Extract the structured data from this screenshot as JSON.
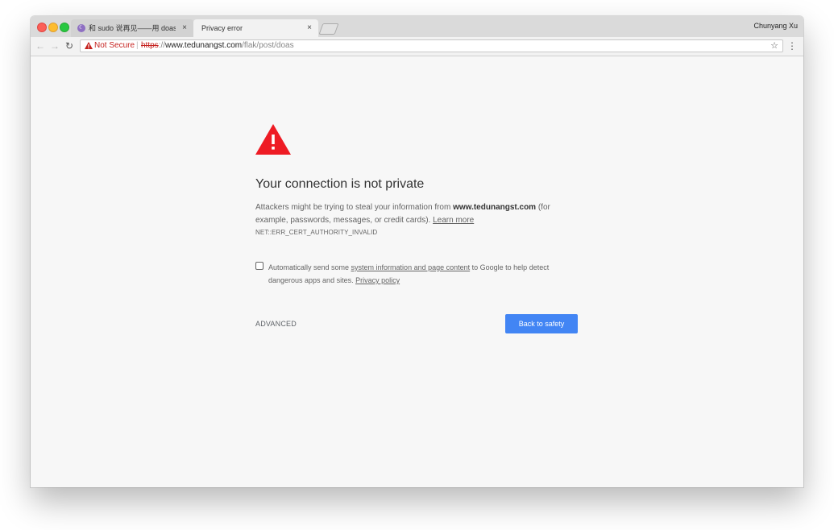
{
  "browser": {
    "tabs": [
      {
        "title": "和 sudo 说再见——用 doas 替代",
        "favicon": "site-favicon",
        "active": false
      },
      {
        "title": "Privacy error",
        "active": true
      }
    ],
    "profile_name": "Chunyang Xu",
    "omnibox": {
      "security_label": "Not Secure",
      "url_scheme": "https",
      "url_separator": "://",
      "url_host": "www.tedunangst.com",
      "url_path": "/flak/post/doas"
    },
    "icons": {
      "back": "←",
      "forward": "→",
      "reload": "↻",
      "star": "☆",
      "menu": "⋮",
      "close": "×"
    }
  },
  "interstitial": {
    "heading": "Your connection is not private",
    "body_before": "Attackers might be trying to steal your information from ",
    "body_host": "www.tedunangst.com",
    "body_after": " (for example, passwords, messages, or credit cards). ",
    "learn_more": "Learn more",
    "error_code": "NET::ERR_CERT_AUTHORITY_INVALID",
    "optin_before": "Automatically send some ",
    "optin_link": "system information and page content",
    "optin_after": " to Google to help detect dangerous apps and sites. ",
    "privacy_policy": "Privacy policy",
    "advanced_label": "ADVANCED",
    "back_button": "Back to safety"
  },
  "colors": {
    "warning_red": "#ee1b24",
    "accent_blue": "#4285f4",
    "not_secure_red": "#c5221f"
  }
}
